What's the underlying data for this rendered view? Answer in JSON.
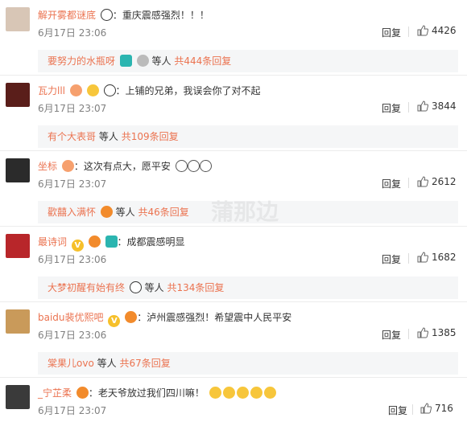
{
  "comments": [
    {
      "user": "解开雾都谜底",
      "text": "重庆震感强烈！！！",
      "time": "6月17日 23:06",
      "reply_label": "回复",
      "likes": "4426",
      "avatar_color": "#d8c6b6",
      "sub": {
        "name": "要努力的水瓶呀",
        "etc": "等人",
        "count": "共444条回复"
      }
    },
    {
      "user": "瓦力lll",
      "text": "上铺的兄弟，我误会你了对不起",
      "time": "6月17日 23:07",
      "reply_label": "回复",
      "likes": "3844",
      "avatar_color": "#5a1e1a",
      "sub": {
        "name": "有个大表哥",
        "etc": "等人",
        "count": "共109条回复"
      }
    },
    {
      "user": "坐标",
      "text": "这次有点大，愿平安",
      "time": "6月17日 23:07",
      "reply_label": "回复",
      "likes": "2612",
      "avatar_color": "#2b2b2b",
      "sub": {
        "name": "歡囍入满怀",
        "etc": "等人",
        "count": "共46条回复"
      }
    },
    {
      "user": "最诗词",
      "text": "成都震感明显",
      "time": "6月17日 23:06",
      "reply_label": "回复",
      "likes": "1682",
      "avatar_color": "#b8262a",
      "sub": {
        "name": "大梦初醒有始有终",
        "etc": "等人",
        "count": "共134条回复"
      }
    },
    {
      "user": "baidu裴优熙吧",
      "text": "泸州震感强烈！希望震中人民平安",
      "time": "6月17日 23:06",
      "reply_label": "回复",
      "likes": "1385",
      "avatar_color": "#c99a5a",
      "sub": {
        "name": "棠果儿ovo",
        "etc": "等人",
        "count": "共67条回复"
      }
    },
    {
      "user": "_宁芷柔",
      "text": "老天爷放过我们四川嘛！",
      "time": "6月17日 23:07",
      "reply_label": "回复",
      "likes": "716",
      "avatar_color": "#3a3a3a"
    }
  ],
  "watermark": "蒲那边",
  "colors": {
    "username": "#eb7350",
    "subbg": "#f5f6f7",
    "meta": "#808080"
  },
  "icons": {
    "like": "thumbs-up-icon",
    "emoji": "emoji-icon"
  }
}
